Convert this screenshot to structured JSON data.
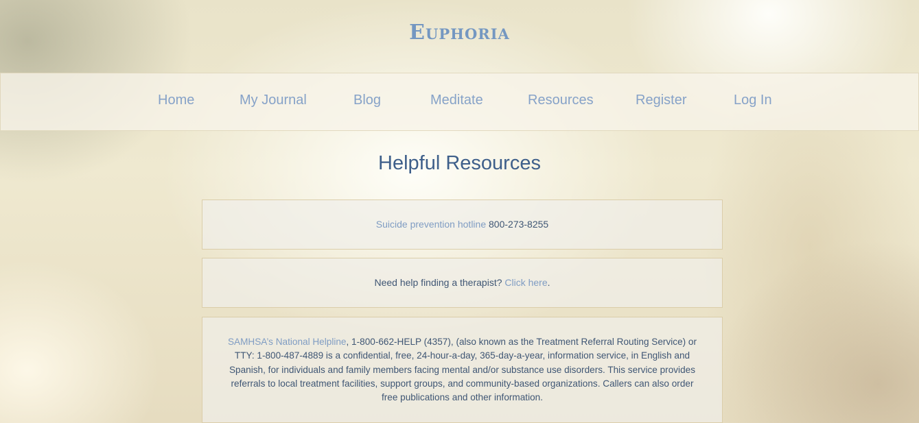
{
  "site": {
    "logo": "Euphoria"
  },
  "nav": {
    "items": [
      {
        "label": "Home"
      },
      {
        "label": "My Journal"
      },
      {
        "label": "Blog"
      },
      {
        "label": "Meditate"
      },
      {
        "label": "Resources"
      },
      {
        "label": "Register"
      },
      {
        "label": "Log In"
      }
    ]
  },
  "main": {
    "title": "Helpful Resources",
    "cards": {
      "hotline": {
        "link": "Suicide prevention hotline",
        "number": "800-273-8255"
      },
      "therapist": {
        "text": "Need help finding a therapist?",
        "link": "Click here",
        "punct": "."
      },
      "samhsa": {
        "link": "SAMHSA’s National Helpline",
        "text": ", 1-800-662-HELP (4357), (also known as the Treatment Referral Routing Service) or TTY: 1-800-487-4889 is a confidential, free, 24-hour-a-day, 365-day-a-year, information service, in English and Spanish, for individuals and family members facing mental and/or substance use disorders. This service provides referrals to local treatment facilities, support groups, and community-based organizations. Callers can also order free publications and other information."
      }
    }
  },
  "colors": {
    "logo": "#7497c1",
    "nav_link": "#86a2c8",
    "title": "#3e5f8a",
    "link": "#7f9cc3",
    "body_text": "#3f5674"
  }
}
